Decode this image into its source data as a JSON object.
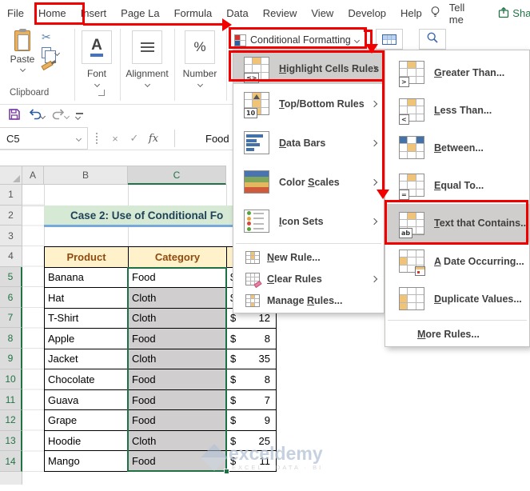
{
  "tabs": {
    "items": [
      "File",
      "Home",
      "Insert",
      "Page La",
      "Formula",
      "Data",
      "Review",
      "View",
      "Develop",
      "Help"
    ],
    "active": "Home",
    "tell_me": "Tell me",
    "share": "Share"
  },
  "ribbon": {
    "paste": "Paste",
    "font_group": "Font",
    "alignment_group": "Alignment",
    "number_group": "Number",
    "clipboard_group": "Clipboard",
    "font_letter": "A",
    "percent": "%",
    "conditional_formatting": "Conditional Formatting"
  },
  "icons": {
    "cut": "✂",
    "cancel": "×",
    "confirm": "✓"
  },
  "formula_bar": {
    "name_box": "C5",
    "fx": "fx",
    "value": "Food"
  },
  "sheet": {
    "columns": [
      "A",
      "B",
      "C"
    ],
    "row_numbers": [
      "1",
      "2",
      "3",
      "4",
      "5",
      "6",
      "7",
      "8",
      "9",
      "10",
      "11",
      "12",
      "13",
      "14"
    ],
    "title": "Case 2: Use of Conditional Fo",
    "table": {
      "headers": [
        "Product",
        "Category",
        ""
      ],
      "rows": [
        {
          "product": "Banana",
          "category": "Food",
          "currency": "$",
          "price": ""
        },
        {
          "product": "Hat",
          "category": "Cloth",
          "currency": "$",
          "price": ""
        },
        {
          "product": "T-Shirt",
          "category": "Cloth",
          "currency": "$",
          "price": "12"
        },
        {
          "product": "Apple",
          "category": "Food",
          "currency": "$",
          "price": "8"
        },
        {
          "product": "Jacket",
          "category": "Cloth",
          "currency": "$",
          "price": "35"
        },
        {
          "product": "Chocolate",
          "category": "Food",
          "currency": "$",
          "price": "8"
        },
        {
          "product": "Guava",
          "category": "Food",
          "currency": "$",
          "price": "7"
        },
        {
          "product": "Grape",
          "category": "Food",
          "currency": "$",
          "price": "9"
        },
        {
          "product": "Hoodie",
          "category": "Cloth",
          "currency": "$",
          "price": "25"
        },
        {
          "product": "Mango",
          "category": "Food",
          "currency": "$",
          "price": "11"
        }
      ]
    }
  },
  "menu": {
    "items": [
      {
        "pre": "",
        "u": "H",
        "rest": "ighlight Cells Rules"
      },
      {
        "pre": "",
        "u": "T",
        "rest": "op/Bottom Rules"
      },
      {
        "pre": "",
        "u": "D",
        "rest": "ata Bars"
      },
      {
        "pre": "Color ",
        "u": "S",
        "rest": "cales"
      },
      {
        "pre": "",
        "u": "I",
        "rest": "con Sets"
      },
      {
        "pre": "",
        "u": "N",
        "rest": "ew Rule..."
      },
      {
        "pre": "",
        "u": "C",
        "rest": "lear Rules"
      },
      {
        "pre": "Manage ",
        "u": "R",
        "rest": "ules..."
      }
    ]
  },
  "submenu": {
    "items": [
      {
        "pre": "",
        "u": "G",
        "rest": "reater Than..."
      },
      {
        "pre": "",
        "u": "L",
        "rest": "ess Than..."
      },
      {
        "pre": "",
        "u": "B",
        "rest": "etween..."
      },
      {
        "pre": "",
        "u": "E",
        "rest": "qual To..."
      },
      {
        "pre": "",
        "u": "T",
        "rest": "ext that Contains..."
      },
      {
        "pre": "",
        "u": "A",
        "rest": " Date Occurring..."
      },
      {
        "pre": "",
        "u": "D",
        "rest": "uplicate Values..."
      },
      {
        "pre": "",
        "u": "M",
        "rest": "ore Rules..."
      }
    ]
  },
  "icon_badges": {
    "highlight_cells": "≤>",
    "top_bottom": "10",
    "greater_than": ">",
    "less_than": "<",
    "equal_to": "=",
    "text_contains": "ab"
  },
  "watermark": {
    "name": "exceldemy",
    "tagline": "EXCEL · DATA · BI"
  },
  "colors": {
    "accent_green": "#217346",
    "annotation_red": "#f20000",
    "selection_gray": "#d0cece",
    "title_bg": "#d6e9d4",
    "table_header_bg": "#fff2cb",
    "table_header_text": "#8f4a0e"
  }
}
